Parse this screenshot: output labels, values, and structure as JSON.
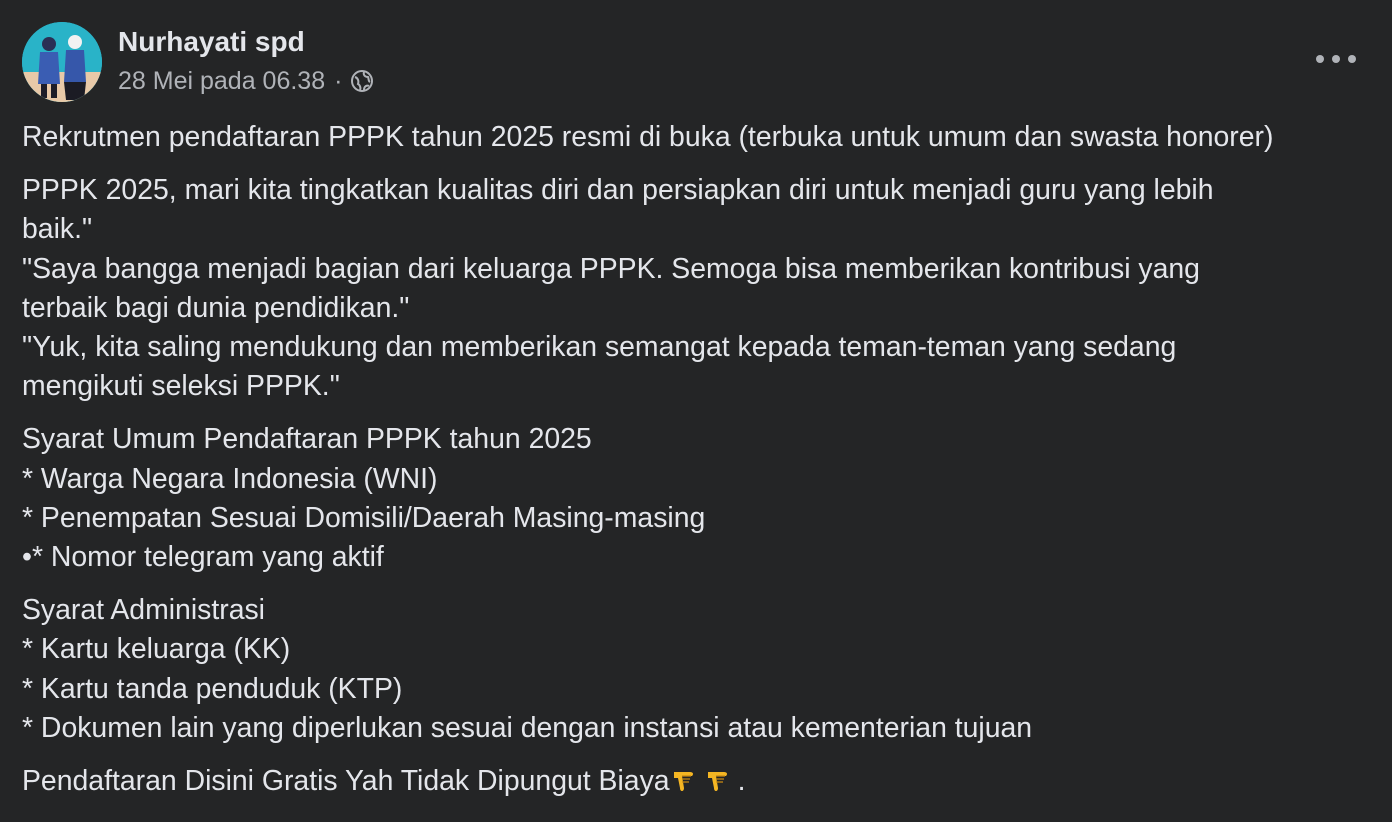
{
  "post": {
    "author": "Nurhayati spd",
    "timestamp": "28 Mei pada 06.38",
    "separator": "·",
    "privacy_icon": "globe-icon",
    "more_icon": "more-options-icon",
    "paragraphs": [
      {
        "lines": [
          "Rekrutmen pendaftaran PPPK tahun 2025 resmi di buka (terbuka untuk umum dan swasta honorer)"
        ]
      },
      {
        "lines": [
          "PPPK 2025, mari kita tingkatkan kualitas diri dan persiapkan diri untuk menjadi guru yang lebih",
          "baik.\"",
          "\"Saya bangga menjadi bagian dari keluarga PPPK. Semoga bisa memberikan kontribusi yang",
          "terbaik bagi dunia pendidikan.\"",
          "\"Yuk, kita saling mendukung dan memberikan semangat kepada teman-teman yang sedang",
          "mengikuti seleksi PPPK.\""
        ]
      },
      {
        "lines": [
          "Syarat Umum Pendaftaran  PPPK tahun 2025",
          "* Warga Negara Indonesia (WNI)",
          "* Penempatan Sesuai Domisili/Daerah Masing-masing",
          "•* Nomor telegram yang aktif"
        ]
      },
      {
        "lines": [
          "Syarat Administrasi",
          "* Kartu keluarga (KK)",
          "* Kartu tanda penduduk (KTP)",
          "* Dokumen lain yang diperlukan sesuai dengan instansi atau kementerian tujuan"
        ]
      }
    ],
    "closing": {
      "text": "Pendaftaran Disini Gratis Yah Tidak Dipungut Biaya",
      "emoji": [
        "pointing-down-emoji",
        "pointing-down-emoji"
      ],
      "suffix": "."
    }
  }
}
